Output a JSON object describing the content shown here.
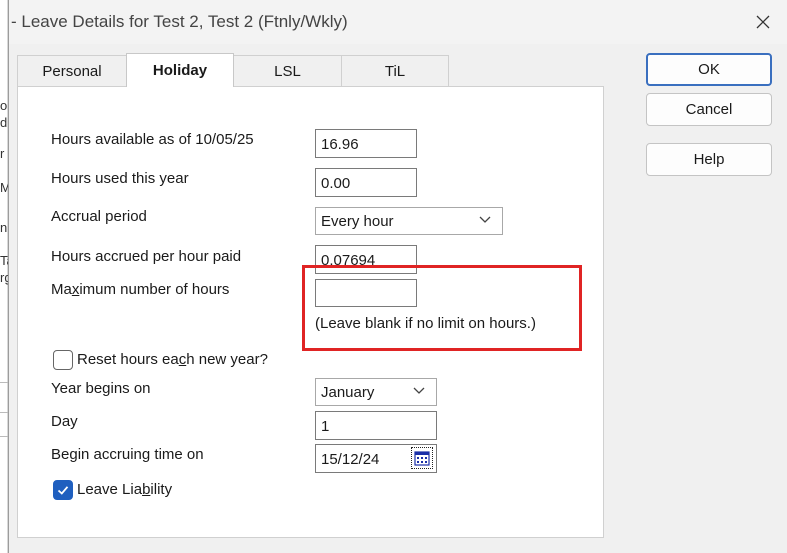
{
  "background_window": {
    "fragments": [
      "ol",
      "d",
      "r",
      "M",
      "n",
      "Ta",
      "rg"
    ]
  },
  "window": {
    "title": "- Leave Details for Test 2, Test 2 (Ftnly/Wkly)"
  },
  "tabs": [
    {
      "label": "Personal",
      "active": false
    },
    {
      "label": "Holiday",
      "active": true
    },
    {
      "label": "LSL",
      "active": false
    },
    {
      "label": "TiL",
      "active": false
    }
  ],
  "form": {
    "hours_available_label": "Hours available as of 10/05/25",
    "hours_available_value": "16.96",
    "hours_used_label": "Hours used this year",
    "hours_used_value": "0.00",
    "accrual_period_label": "Accrual period",
    "accrual_period_value": "Every hour",
    "hours_accrued_label": "Hours accrued per hour paid",
    "hours_accrued_value": "0.07694",
    "max_hours_label_pre": "Ma",
    "max_hours_label_u": "x",
    "max_hours_label_post": "imum number of hours",
    "max_hours_value": "",
    "max_hours_hint": "(Leave blank if no limit on hours.)",
    "reset_label_pre": "Reset hours ea",
    "reset_label_u": "c",
    "reset_label_post": "h new year?",
    "reset_checked": false,
    "year_begins_label": "Year begins on",
    "year_begins_value": "January",
    "day_label": "Day",
    "day_value": "1",
    "begin_accruing_label": "Begin accruing time on",
    "begin_accruing_value": "15/12/24",
    "leave_liability_pre": "Leave Lia",
    "leave_liability_u": "b",
    "leave_liability_post": "ility",
    "leave_liability_checked": true
  },
  "buttons": {
    "ok": "OK",
    "cancel": "Cancel",
    "help": "Help"
  },
  "colors": {
    "highlight": "#e02424",
    "checkbox_checked": "#1f5fbf",
    "primary_border": "#3a6fbf"
  }
}
